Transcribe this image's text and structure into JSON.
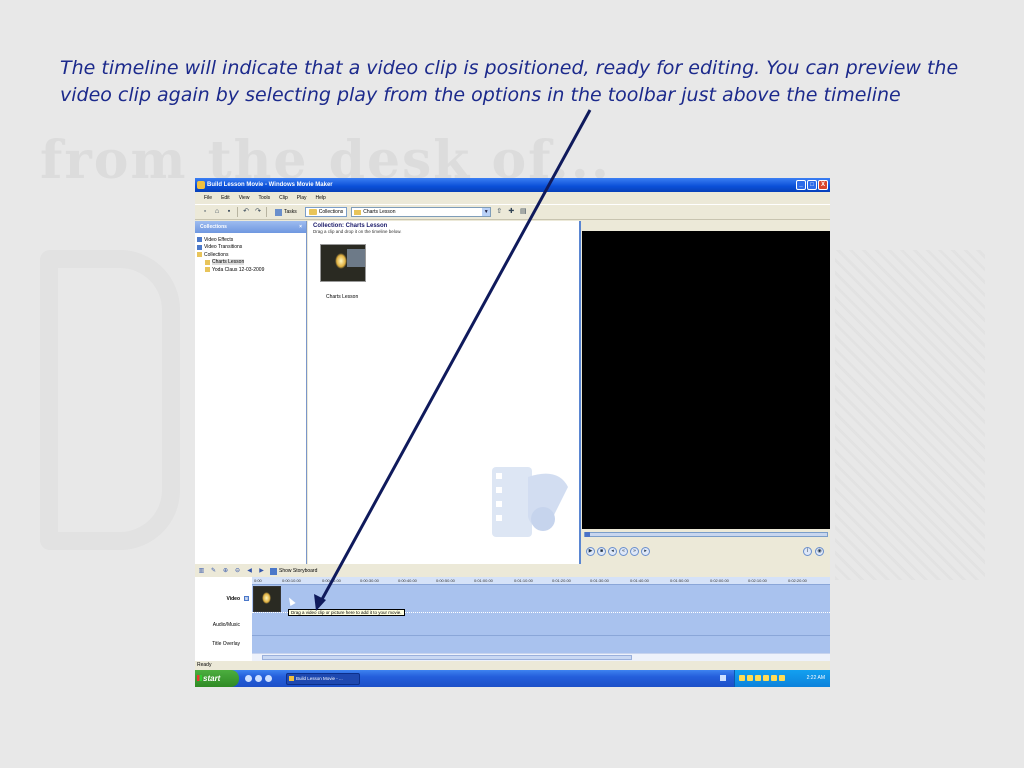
{
  "caption": {
    "text": "The timeline will indicate that a video clip is positioned, ready for editing.  You can preview the video clip again by selecting play from the options in the toolbar just above the timeline"
  },
  "window": {
    "title": "Build Lesson Movie - Windows Movie Maker",
    "controls": [
      "_",
      "□",
      "X"
    ]
  },
  "menu": [
    "File",
    "Edit",
    "View",
    "Tools",
    "Clip",
    "Play",
    "Help"
  ],
  "toolbar": {
    "tasks_label": "Tasks",
    "collections_label": "Collections",
    "collection_selected": "Charts Lesson"
  },
  "collections_pane": {
    "header": "Collections",
    "close": "×",
    "items": [
      {
        "label": "Video Effects",
        "icon": "video-effects-icon"
      },
      {
        "label": "Video Transitions",
        "icon": "video-transitions-icon"
      },
      {
        "label": "Collections",
        "icon": "folder-icon"
      },
      {
        "label": "Charts Lesson",
        "icon": "folder-icon",
        "selected": true
      },
      {
        "label": "Yoda Claus 12-03-2009",
        "icon": "folder-icon"
      }
    ]
  },
  "content_pane": {
    "title": "Collection: Charts Lesson",
    "hint": "Drag a clip and drop it on the timeline below.",
    "clip_label": "Charts Lesson"
  },
  "timeline_toolbar": {
    "storyboard_label": "Show Storyboard"
  },
  "timeline": {
    "tracks": {
      "video": "Video",
      "audio": "Audio/Music",
      "title": "Title Overlay"
    },
    "expand": "⊟",
    "ruler": [
      "0:00",
      "0:00:10.00",
      "0:00:20.00",
      "0:00:30.00",
      "0:00:40.00",
      "0:00:50.00",
      "0:01:00.00",
      "0:01:10.00",
      "0:01:20.00",
      "0:01:30.00",
      "0:01:40.00",
      "0:01:50.00",
      "0:02:00.00",
      "0:02:10.00",
      "0:02:20.00"
    ],
    "tooltip": "Drag a video clip or picture here to add it to your movie."
  },
  "statusbar": {
    "text": "Ready"
  },
  "taskbar": {
    "start": "start",
    "task_button": "Build Lesson Movie - ...",
    "clock": "2:22 AM"
  },
  "colors": {
    "caption": "#1c2a8c",
    "arrow": "#0f1a5c",
    "titlebar": "#0a4fd8"
  }
}
